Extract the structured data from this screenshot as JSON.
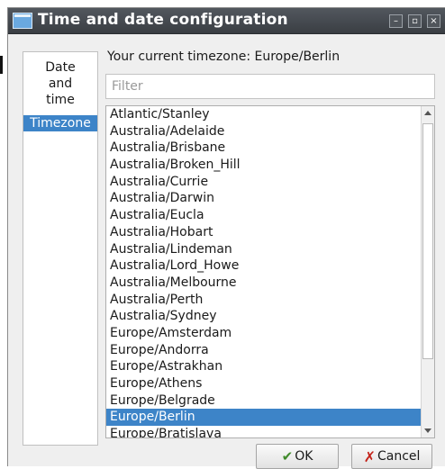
{
  "window": {
    "title": "Time and date configuration",
    "controls": {
      "minimize": "–",
      "restore": "▫",
      "close": "×"
    }
  },
  "sidebar": {
    "items": [
      {
        "label": "Date and time",
        "selected": false
      },
      {
        "label": "Timezone",
        "selected": true
      }
    ]
  },
  "main": {
    "current_timezone": "Your current timezone:  Europe/Berlin",
    "filter_placeholder": "Filter",
    "filter_value": "",
    "timezones": [
      "Atlantic/Stanley",
      "Australia/Adelaide",
      "Australia/Brisbane",
      "Australia/Broken_Hill",
      "Australia/Currie",
      "Australia/Darwin",
      "Australia/Eucla",
      "Australia/Hobart",
      "Australia/Lindeman",
      "Australia/Lord_Howe",
      "Australia/Melbourne",
      "Australia/Perth",
      "Australia/Sydney",
      "Europe/Amsterdam",
      "Europe/Andorra",
      "Europe/Astrakhan",
      "Europe/Athens",
      "Europe/Belgrade",
      "Europe/Berlin",
      "Europe/Bratislava"
    ],
    "selected_timezone": "Europe/Berlin"
  },
  "buttons": {
    "ok": "OK",
    "cancel": "Cancel"
  },
  "colors": {
    "titlebar": "#464a50",
    "selection": "#3d84c8",
    "window_bg": "#efefef"
  }
}
